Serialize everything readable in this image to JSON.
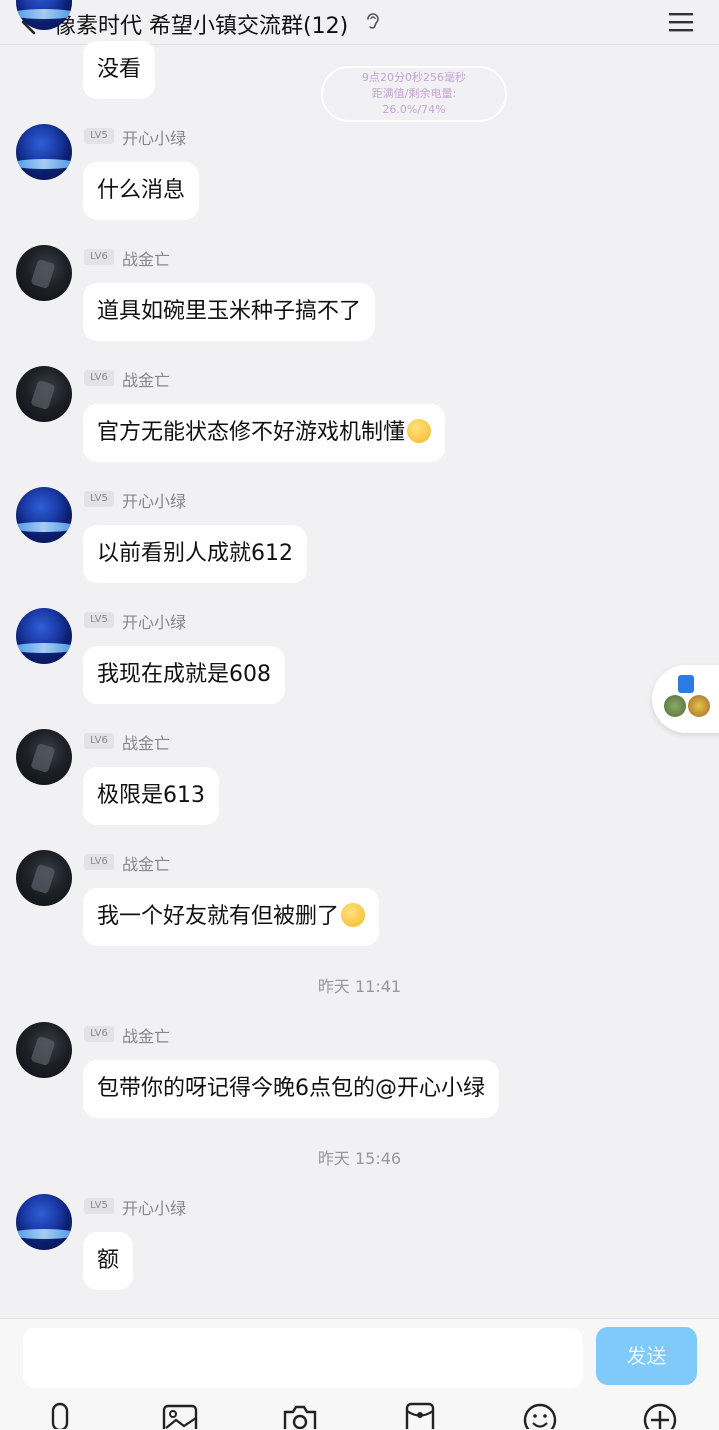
{
  "header": {
    "title": "像素时代 希望小镇交流群(12)"
  },
  "overlay": {
    "line1": "9点20分0秒256毫秒",
    "line2": "距满值/剩余电量:",
    "line3": "26.0%/74%"
  },
  "first_message": {
    "text": "没看"
  },
  "messages": [
    {
      "level": "LV5",
      "nick": "开心小绿",
      "avatar": "blue",
      "text": "什么消息"
    },
    {
      "level": "LV6",
      "nick": "战金亡",
      "avatar": "dark",
      "text": "道具如碗里玉米种子搞不了"
    },
    {
      "level": "LV6",
      "nick": "战金亡",
      "avatar": "dark",
      "text": "官方无能状态修不好游戏机制懂"
    },
    {
      "level": "LV5",
      "nick": "开心小绿",
      "avatar": "blue",
      "text": "以前看别人成就612"
    },
    {
      "level": "LV5",
      "nick": "开心小绿",
      "avatar": "blue",
      "text": "我现在成就是608"
    },
    {
      "level": "LV6",
      "nick": "战金亡",
      "avatar": "dark",
      "text": "极限是613"
    },
    {
      "level": "LV6",
      "nick": "战金亡",
      "avatar": "dark",
      "text": "我一个好友就有但被删了"
    },
    {
      "level": "LV6",
      "nick": "战金亡",
      "avatar": "dark",
      "text": "包带你的呀记得今晚6点包的@开心小绿"
    },
    {
      "level": "LV5",
      "nick": "开心小绿",
      "avatar": "blue",
      "text": "额"
    }
  ],
  "timestamps": [
    "昨天 11:41",
    "昨天 15:46"
  ],
  "input": {
    "value": "",
    "send_label": "发送"
  },
  "toolbar_icons": [
    "microphone-icon",
    "image-icon",
    "camera-icon",
    "red-packet-icon",
    "emoji-icon",
    "plus-icon"
  ],
  "colors": {
    "send_button": "#7fcafb",
    "background": "#f1f1f3"
  }
}
